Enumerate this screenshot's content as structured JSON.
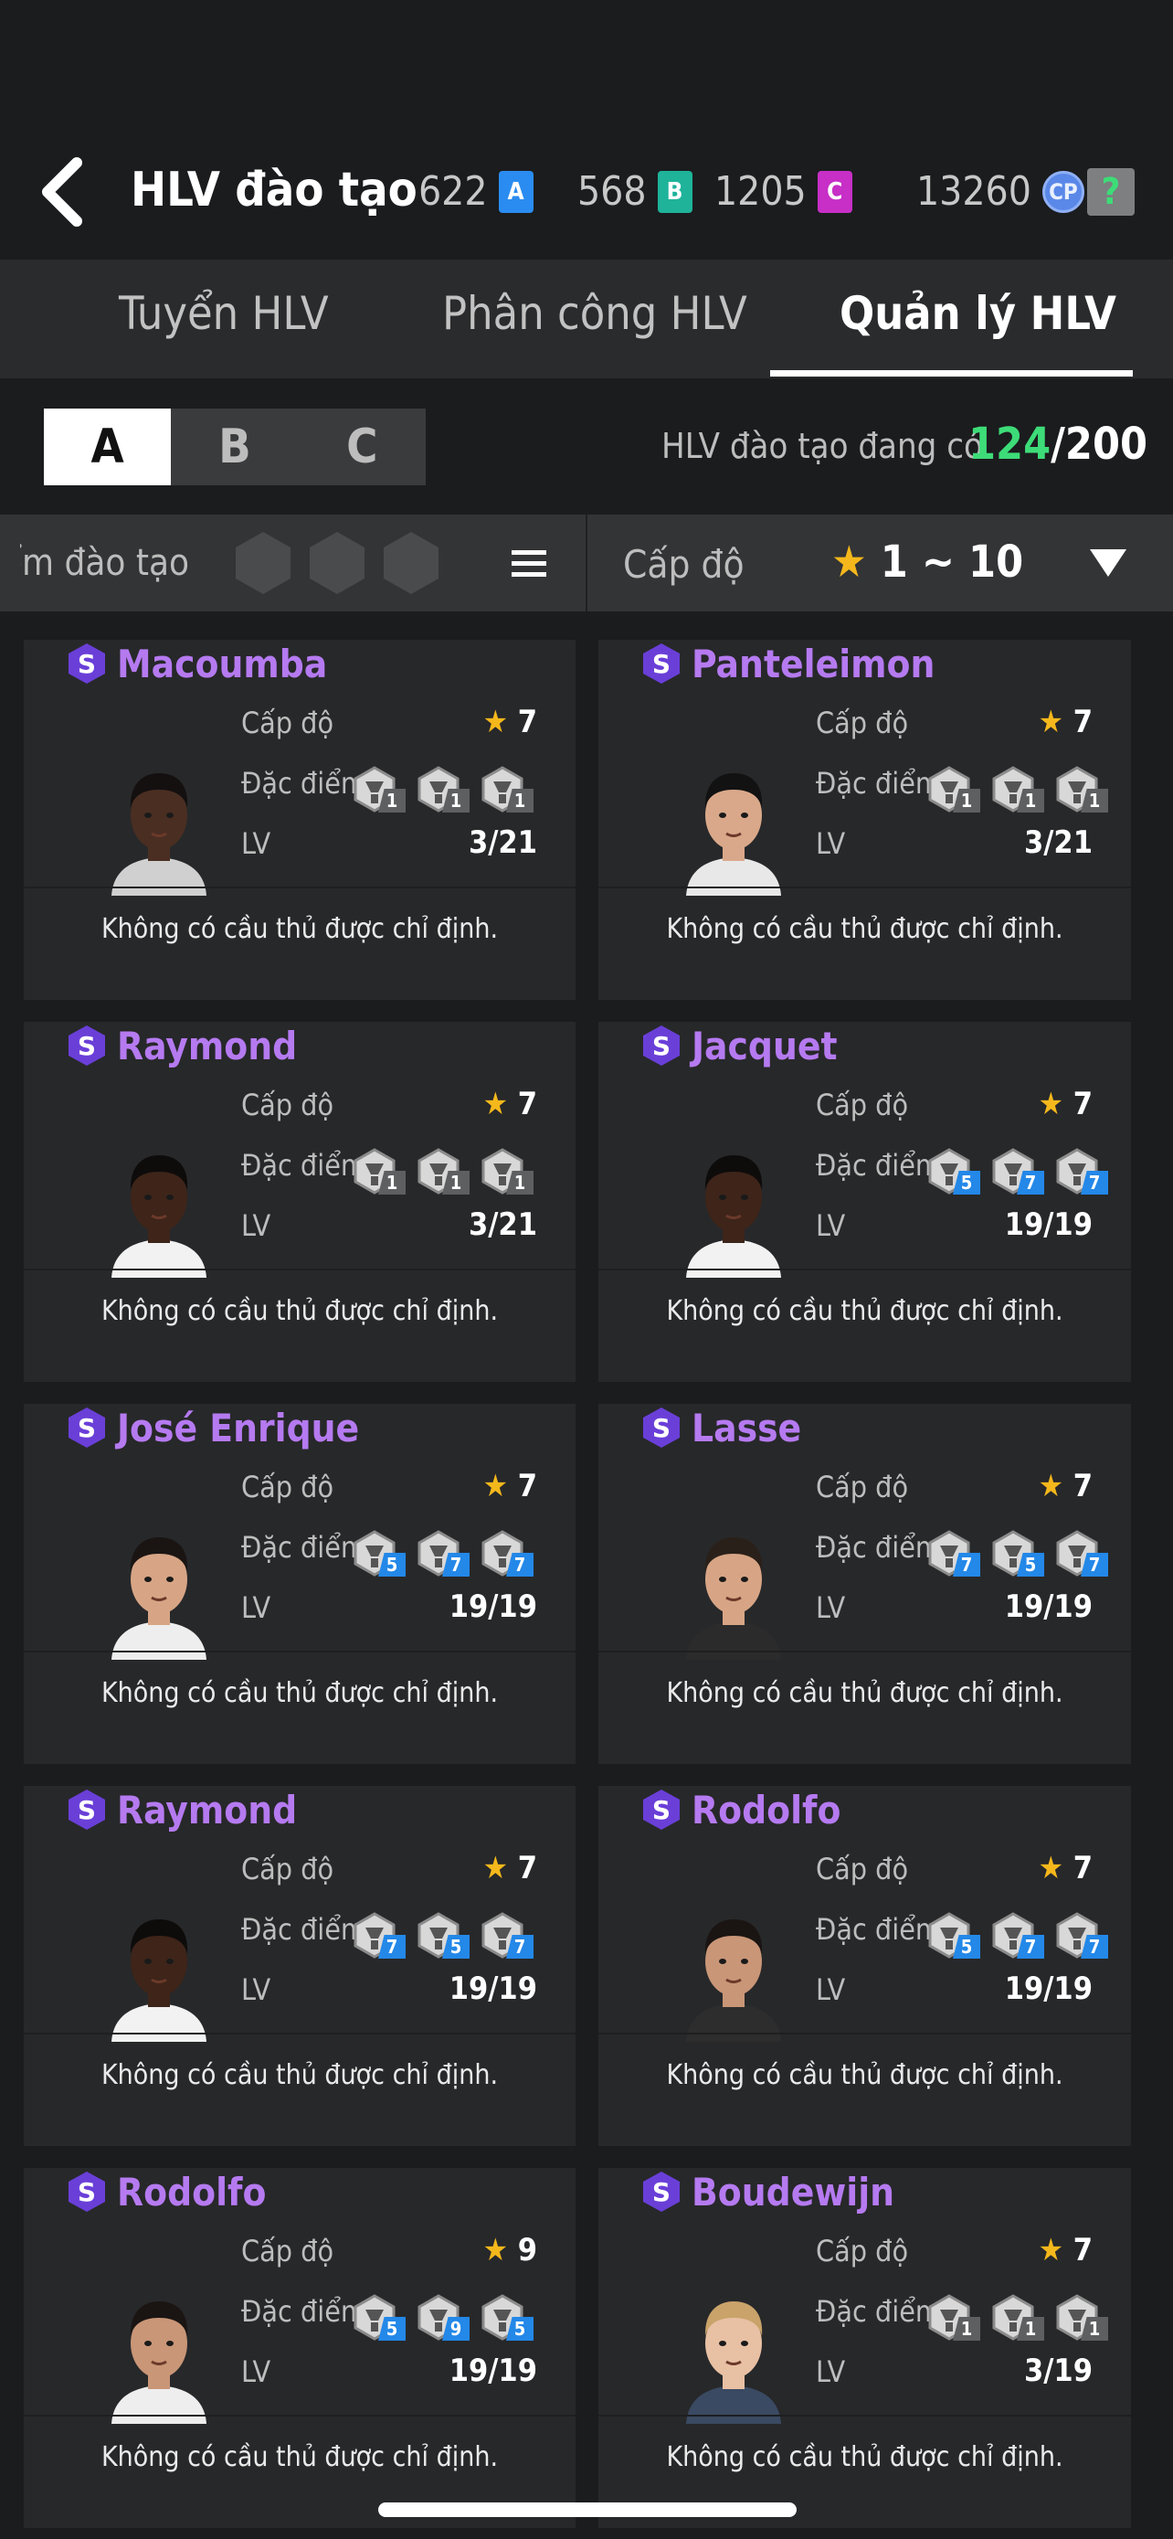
{
  "header": {
    "title": "HLV đào tạo",
    "currencies": [
      {
        "value": "622",
        "badge": "A",
        "color": "#2a8cf0"
      },
      {
        "value": "568",
        "badge": "B",
        "color": "#1fb39a"
      },
      {
        "value": "1205",
        "badge": "C",
        "color": "#c72fc7"
      }
    ],
    "cp": {
      "value": "13260",
      "badge": "CP"
    },
    "help": "?"
  },
  "tabs": [
    {
      "label": "Tuyển HLV",
      "active": false
    },
    {
      "label": "Phân công  HLV",
      "active": false
    },
    {
      "label": "Quản lý HLV",
      "active": true
    }
  ],
  "segments": [
    "A",
    "B",
    "C"
  ],
  "count": {
    "label": "HLV đào tạo đang có",
    "current": "124",
    "max": "/200"
  },
  "filter": {
    "trait_label": "Đặc điểm đào tạo",
    "level_label": "Cấp độ",
    "level_range_star": "★",
    "level_range": " 1 ~ 10"
  },
  "labels": {
    "level": "Cấp độ",
    "traits": "Đặc điểm",
    "lv": "LV",
    "star": "★"
  },
  "coaches": [
    {
      "name": "Macoumba",
      "grade": "7",
      "lv": "3/21",
      "footer": "Không có cầu thủ được chỉ định.",
      "traits": [
        "1",
        "1",
        "1"
      ],
      "trait_colors": [
        "gray",
        "gray",
        "gray"
      ],
      "skin": "#4a2e22",
      "hair": "#141010",
      "shirt": "#d0d0d0"
    },
    {
      "name": "Panteleimon",
      "grade": "7",
      "lv": "3/21",
      "footer": "Không có cầu thủ được chỉ định.",
      "traits": [
        "1",
        "1",
        "1"
      ],
      "trait_colors": [
        "gray",
        "gray",
        "gray"
      ],
      "skin": "#d9a88a",
      "hair": "#121212",
      "shirt": "#e8e8e8"
    },
    {
      "name": "Raymond",
      "grade": "7",
      "lv": "3/21",
      "footer": "Không có cầu thủ được chỉ định.",
      "traits": [
        "1",
        "1",
        "1"
      ],
      "trait_colors": [
        "gray",
        "gray",
        "gray"
      ],
      "skin": "#3e2419",
      "hair": "#0e0c0b",
      "shirt": "#f2f2f2"
    },
    {
      "name": "Jacquet",
      "grade": "7",
      "lv": "19/19",
      "footer": "Không có cầu thủ được chỉ định.",
      "traits": [
        "5",
        "7",
        "7"
      ],
      "trait_colors": [
        "blue",
        "blue",
        "blue"
      ],
      "skin": "#3e2419",
      "hair": "#0e0c0b",
      "shirt": "#f2f2f2"
    },
    {
      "name": "José Enrique",
      "grade": "7",
      "lv": "19/19",
      "footer": "Không có cầu thủ được chỉ định.",
      "traits": [
        "5",
        "7",
        "7"
      ],
      "trait_colors": [
        "blue",
        "blue",
        "blue"
      ],
      "skin": "#d7a585",
      "hair": "#1a1513",
      "shirt": "#eeeeee"
    },
    {
      "name": "Lasse",
      "grade": "7",
      "lv": "19/19",
      "footer": "Không có cầu thủ được chỉ định.",
      "traits": [
        "7",
        "5",
        "7"
      ],
      "trait_colors": [
        "blue",
        "blue",
        "blue"
      ],
      "skin": "#d7a585",
      "hair": "#2a201a",
      "shirt": "#2b2b2b"
    },
    {
      "name": "Raymond",
      "grade": "7",
      "lv": "19/19",
      "footer": "Không có cầu thủ được chỉ định.",
      "traits": [
        "7",
        "5",
        "7"
      ],
      "trait_colors": [
        "blue",
        "blue",
        "blue"
      ],
      "skin": "#3e2419",
      "hair": "#0e0c0b",
      "shirt": "#f2f2f2"
    },
    {
      "name": "Rodolfo",
      "grade": "7",
      "lv": "19/19",
      "footer": "Không có cầu thủ được chỉ định.",
      "traits": [
        "5",
        "7",
        "7"
      ],
      "trait_colors": [
        "blue",
        "blue",
        "blue"
      ],
      "skin": "#c99677",
      "hair": "#1a1513",
      "shirt": "#2d2d2d"
    },
    {
      "name": "Rodolfo",
      "grade": "9",
      "lv": "19/19",
      "footer": "Không có cầu thủ được chỉ định.",
      "traits": [
        "5",
        "9",
        "5"
      ],
      "trait_colors": [
        "blue",
        "blue",
        "blue"
      ],
      "skin": "#c99677",
      "hair": "#1a1513",
      "shirt": "#eeeeee"
    },
    {
      "name": "Boudewijn",
      "grade": "7",
      "lv": "3/19",
      "footer": "Không có cầu thủ được chỉ định.",
      "traits": [
        "1",
        "1",
        "1"
      ],
      "trait_colors": [
        "gray",
        "gray",
        "gray"
      ],
      "skin": "#e8c0a4",
      "hair": "#c9a36a",
      "shirt": "#3a4a62"
    }
  ]
}
